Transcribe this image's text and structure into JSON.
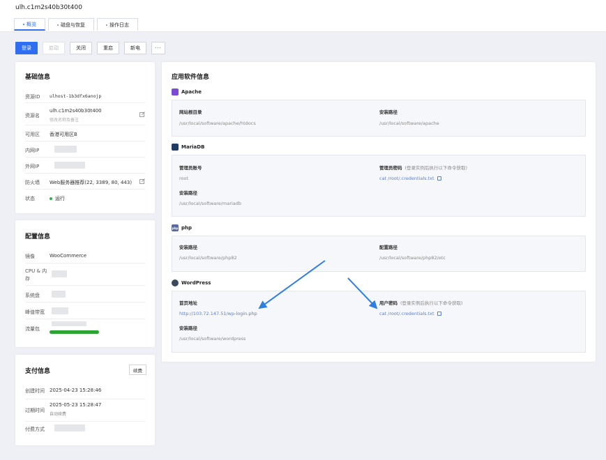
{
  "header": {
    "title": "ulh.c1m2s40b30t400",
    "tabs": [
      {
        "label": "概览"
      },
      {
        "label": "磁盘与恢复"
      },
      {
        "label": "操作日志"
      }
    ]
  },
  "actions": {
    "login": "登录",
    "start": "启动",
    "shutdown": "关闭",
    "restart": "重启",
    "new": "新电",
    "more": "···"
  },
  "basic": {
    "title": "基础信息",
    "rows": {
      "id_label": "资源ID",
      "id_value": "ulhost-1b3dfx6anojp",
      "name_label": "资源名",
      "name_value": "ulh.c1m2s40b30t400",
      "name_note": "修改名称及备注",
      "zone_label": "可用区",
      "zone_value": "香港可用区B",
      "private_ip_label": "内网IP",
      "public_ip_label": "外网IP",
      "firewall_label": "防火墙",
      "firewall_value": "Web服务器推荐(22, 3389, 80, 443)",
      "status_label": "状态",
      "status_value": "运行"
    }
  },
  "config": {
    "title": "配置信息",
    "rows": {
      "image_label": "镜像",
      "image_value": "WooCommerce",
      "cpu_label_1": "CPU & 内",
      "cpu_label_2": "存",
      "disk_label": "系统盘",
      "bandwidth_label": "峰值带宽",
      "traffic_label": "流量包"
    },
    "traffic_fill_fraction": 1.0,
    "traffic_color": "#2aa532"
  },
  "payment": {
    "title": "支付信息",
    "renew_button": "续费",
    "rows": {
      "created_label": "创建时间",
      "created_value": "2025-04-23 15:28:46",
      "expire_label": "过期时间",
      "expire_value": "2025-05-23 15:28:47",
      "auto_renew": "自动续费",
      "pay_method_label": "付费方式"
    }
  },
  "apps": {
    "title": "应用软件信息",
    "apache": {
      "name": "Apache",
      "root_label": "网站根目录",
      "root_value": "/usr/local/software/apache/htdocs",
      "path_label": "安装路径",
      "path_value": "/usr/local/software/apache"
    },
    "mariadb": {
      "name": "MariaDB",
      "admin_label": "管理员账号",
      "admin_value": "root",
      "pwd_label": "管理员密码",
      "pwd_hint": "(登录实例后执行以下命令获取)",
      "pwd_cmd": "cat /root/.credentials.txt",
      "path_label": "安装路径",
      "path_value": "/usr/local/software/mariadb"
    },
    "php": {
      "name": "php",
      "logo_text": "php",
      "path_label": "安装路径",
      "path_value": "/usr/local/software/php82",
      "conf_label": "配置路径",
      "conf_value": "/usr/local/software/php82/etc"
    },
    "wordpress": {
      "name": "WordPress",
      "home_label": "首页地址",
      "home_value": "http://103.72.147.51/wp-login.php",
      "pwd_label": "用户密码",
      "pwd_hint": "(登录实例后执行以下命令获取)",
      "pwd_cmd": "cat /root/.credentials.txt",
      "path_label": "安装路径",
      "path_value": "/usr/local/software/wordpress"
    }
  },
  "colors": {
    "accent": "#2f6ef0",
    "arrow": "#2f7fe0",
    "status_green": "#2bb24c"
  }
}
